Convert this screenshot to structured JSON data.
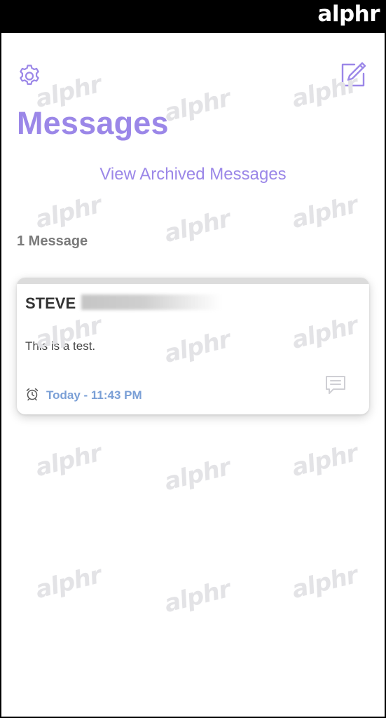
{
  "brand": {
    "text": "alphr"
  },
  "watermark": {
    "text": "alphr"
  },
  "header": {
    "settings_icon": "gear-icon",
    "compose_icon": "compose-icon",
    "title": "Messages"
  },
  "archived_link": "View Archived Messages",
  "count_label": "1 Message",
  "message": {
    "sender": "STEVE",
    "body": "This is a test.",
    "timestamp": "Today - 11:43 PM",
    "time_icon": "alarm-clock-icon",
    "reply_icon": "chat-bubble-icon"
  },
  "colors": {
    "accent": "#9b87e8",
    "timestamp": "#7a9fd6",
    "card_strip": "#dcdcdc"
  }
}
